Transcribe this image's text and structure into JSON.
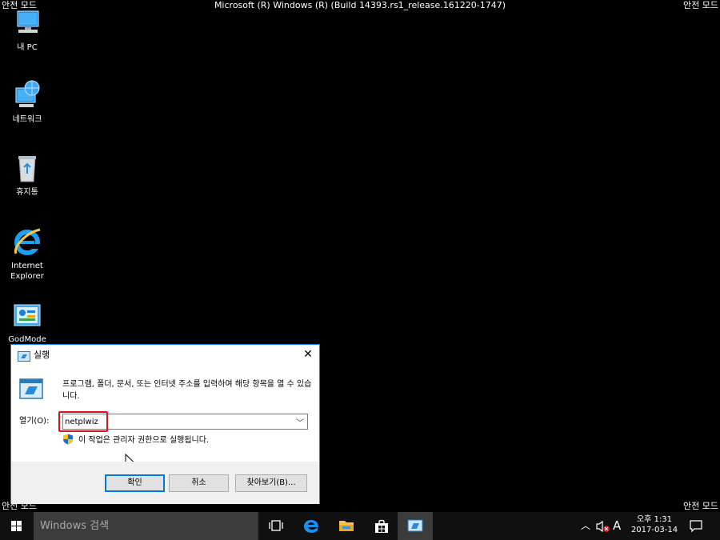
{
  "desktop": {
    "safe_mode_label": "안전 모드",
    "build_info": "Microsoft (R) Windows (R) (Build 14393.rs1_release.161220-1747)",
    "icons": [
      {
        "label": "내 PC",
        "icon": "computer-icon"
      },
      {
        "label": "네트워크",
        "icon": "network-icon"
      },
      {
        "label": "휴지통",
        "icon": "recycle-bin-icon"
      },
      {
        "label": "Internet\nExplorer",
        "icon": "internet-explorer-icon"
      },
      {
        "label": "GodMode",
        "icon": "control-panel-icon"
      }
    ]
  },
  "run_dialog": {
    "title": "실행",
    "close_glyph": "✕",
    "description": "프로그램, 폴더, 문서, 또는 인터넷 주소를 입력하여 해당 항목을 열 수 있습니다.",
    "open_label": "열기(O):",
    "open_value": "netplwiz",
    "admin_note": "이 작업은 관리자 권한으로 실행됩니다.",
    "buttons": {
      "ok": "확인",
      "cancel": "취소",
      "browse": "찾아보기(B)..."
    },
    "highlight_color": "#d7141e",
    "accent_color": "#0078d7"
  },
  "taskbar": {
    "search_placeholder": "Windows 검색",
    "pinned": [
      "task-view-icon",
      "edge-icon",
      "file-explorer-icon",
      "store-icon",
      "run-icon"
    ],
    "ime_indicator": "A",
    "time": "오후 1:31",
    "date": "2017-03-14"
  }
}
